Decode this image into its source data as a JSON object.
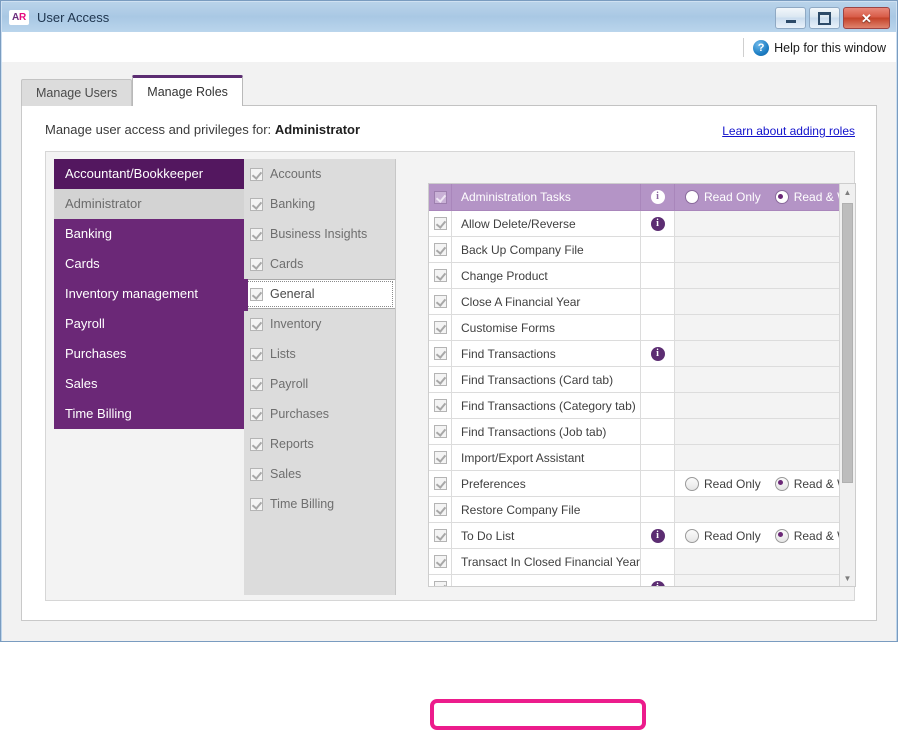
{
  "window": {
    "app_icon_a": "A",
    "app_icon_r": "R",
    "title": "User Access",
    "minimize_label": "",
    "maximize_label": "",
    "close_label": "✕"
  },
  "help": {
    "icon": "help-icon",
    "label": "Help for this window"
  },
  "tabs": [
    {
      "label": "Manage Users",
      "active": false
    },
    {
      "label": "Manage Roles",
      "active": true
    }
  ],
  "panel": {
    "header_prefix": "Manage user access and privileges for:",
    "header_role": "Administrator",
    "learn_link": "Learn about adding roles"
  },
  "roles": [
    {
      "label": "Accountant/Bookkeeper",
      "state": "hover"
    },
    {
      "label": "Administrator",
      "state": "selected"
    },
    {
      "label": "Banking",
      "state": "normal"
    },
    {
      "label": "Cards",
      "state": "normal"
    },
    {
      "label": "Inventory management",
      "state": "normal"
    },
    {
      "label": "Payroll",
      "state": "normal"
    },
    {
      "label": "Purchases",
      "state": "normal"
    },
    {
      "label": "Sales",
      "state": "normal"
    },
    {
      "label": "Time Billing",
      "state": "normal"
    }
  ],
  "categories": [
    {
      "label": "Accounts",
      "checked": true,
      "selected": false
    },
    {
      "label": "Banking",
      "checked": true,
      "selected": false
    },
    {
      "label": "Business Insights",
      "checked": true,
      "selected": false
    },
    {
      "label": "Cards",
      "checked": true,
      "selected": false
    },
    {
      "label": "General",
      "checked": true,
      "selected": true
    },
    {
      "label": "Inventory",
      "checked": true,
      "selected": false
    },
    {
      "label": "Lists",
      "checked": true,
      "selected": false
    },
    {
      "label": "Payroll",
      "checked": true,
      "selected": false
    },
    {
      "label": "Purchases",
      "checked": true,
      "selected": false
    },
    {
      "label": "Reports",
      "checked": true,
      "selected": false
    },
    {
      "label": "Sales",
      "checked": true,
      "selected": false
    },
    {
      "label": "Time Billing",
      "checked": true,
      "selected": false
    }
  ],
  "permission_labels": {
    "read_only": "Read Only",
    "read_write": "Read & Write"
  },
  "tasks_header": {
    "label": "Administration Tasks",
    "checked": true,
    "info": true,
    "read_only_selected": false,
    "read_write_selected": true
  },
  "tasks": [
    {
      "label": "Allow Delete/Reverse",
      "checked": true,
      "info": true,
      "radios": false
    },
    {
      "label": "Back Up Company File",
      "checked": true,
      "info": false,
      "radios": false
    },
    {
      "label": "Change Product",
      "checked": true,
      "info": false,
      "radios": false
    },
    {
      "label": "Close A Financial Year",
      "checked": true,
      "info": false,
      "radios": false
    },
    {
      "label": "Customise Forms",
      "checked": true,
      "info": false,
      "radios": false
    },
    {
      "label": "Find Transactions",
      "checked": true,
      "info": true,
      "radios": false
    },
    {
      "label": "Find Transactions (Card tab)",
      "checked": true,
      "info": false,
      "radios": false
    },
    {
      "label": "Find Transactions (Category tab)",
      "checked": true,
      "info": false,
      "radios": false
    },
    {
      "label": "Find Transactions (Job tab)",
      "checked": true,
      "info": false,
      "radios": false
    },
    {
      "label": "Import/Export Assistant",
      "checked": true,
      "info": false,
      "radios": false
    },
    {
      "label": "Preferences",
      "checked": true,
      "info": false,
      "radios": true,
      "read_write_selected": true
    },
    {
      "label": "Restore Company File",
      "checked": true,
      "info": false,
      "radios": false
    },
    {
      "label": "To Do List",
      "checked": true,
      "info": true,
      "radios": true,
      "read_write_selected": true
    },
    {
      "label": "Transact In Closed Financial Years",
      "checked": true,
      "info": false,
      "radios": false,
      "highlighted": true
    },
    {
      "label": "",
      "checked": true,
      "info": true,
      "radios": false
    }
  ],
  "scrollbar": {
    "up_arrow": "▲",
    "down_arrow": "▼"
  },
  "colors": {
    "brand_purple": "#6b2877",
    "dark_purple": "#53175f",
    "header_purple": "#b494c6",
    "annotation_pink": "#ec1c8c",
    "link_blue": "#1111cc"
  }
}
